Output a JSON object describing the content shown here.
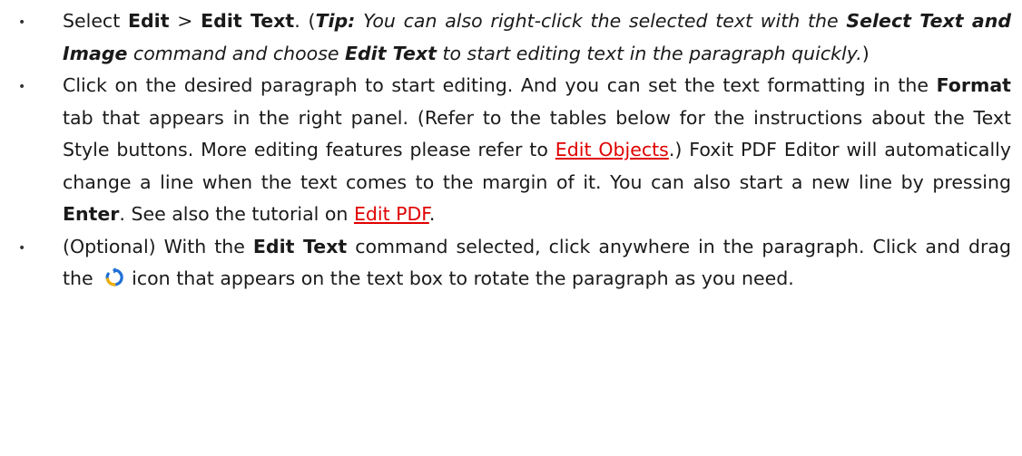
{
  "bullet_glyph": "•",
  "colors": {
    "link": "#e00000",
    "icon_blue": "#1f6fd6",
    "icon_yellow": "#f0b000"
  },
  "step1": {
    "t1": "Select ",
    "b1": "Edit",
    "t2": " > ",
    "b2": "Edit Text",
    "t3": ". (",
    "tip_label": "Tip:",
    "tip_t1": " You can also right-click the selected text with the ",
    "tip_b1": "Select Text and Image",
    "tip_t2": " command and choose ",
    "tip_b2": "Edit Text",
    "tip_t3": " to start editing text in the paragraph quickly.",
    "t4": ")"
  },
  "step2": {
    "t1": "Click on the desired paragraph to start editing. And you can set the text formatting in the ",
    "b1": "Format",
    "t2": " tab that appears in the right panel. (Refer to the tables below for the instructions about the Text Style buttons. More editing features please refer to ",
    "link1": "Edit Objects",
    "t3": ".) Foxit PDF Editor will automatically change a line when the text comes to the margin of it. You can also start a new line by pressing ",
    "b2": "Enter",
    "t4": ". See also the tutorial on ",
    "link2": "Edit PDF",
    "t5": "."
  },
  "step3": {
    "t1": "(Optional) With the ",
    "b1": "Edit Text",
    "t2": " command selected, click anywhere in the paragraph. Click and drag the ",
    "icon_name": "rotate-icon",
    "t3": "icon that appears on the text box to rotate the paragraph as you need."
  }
}
